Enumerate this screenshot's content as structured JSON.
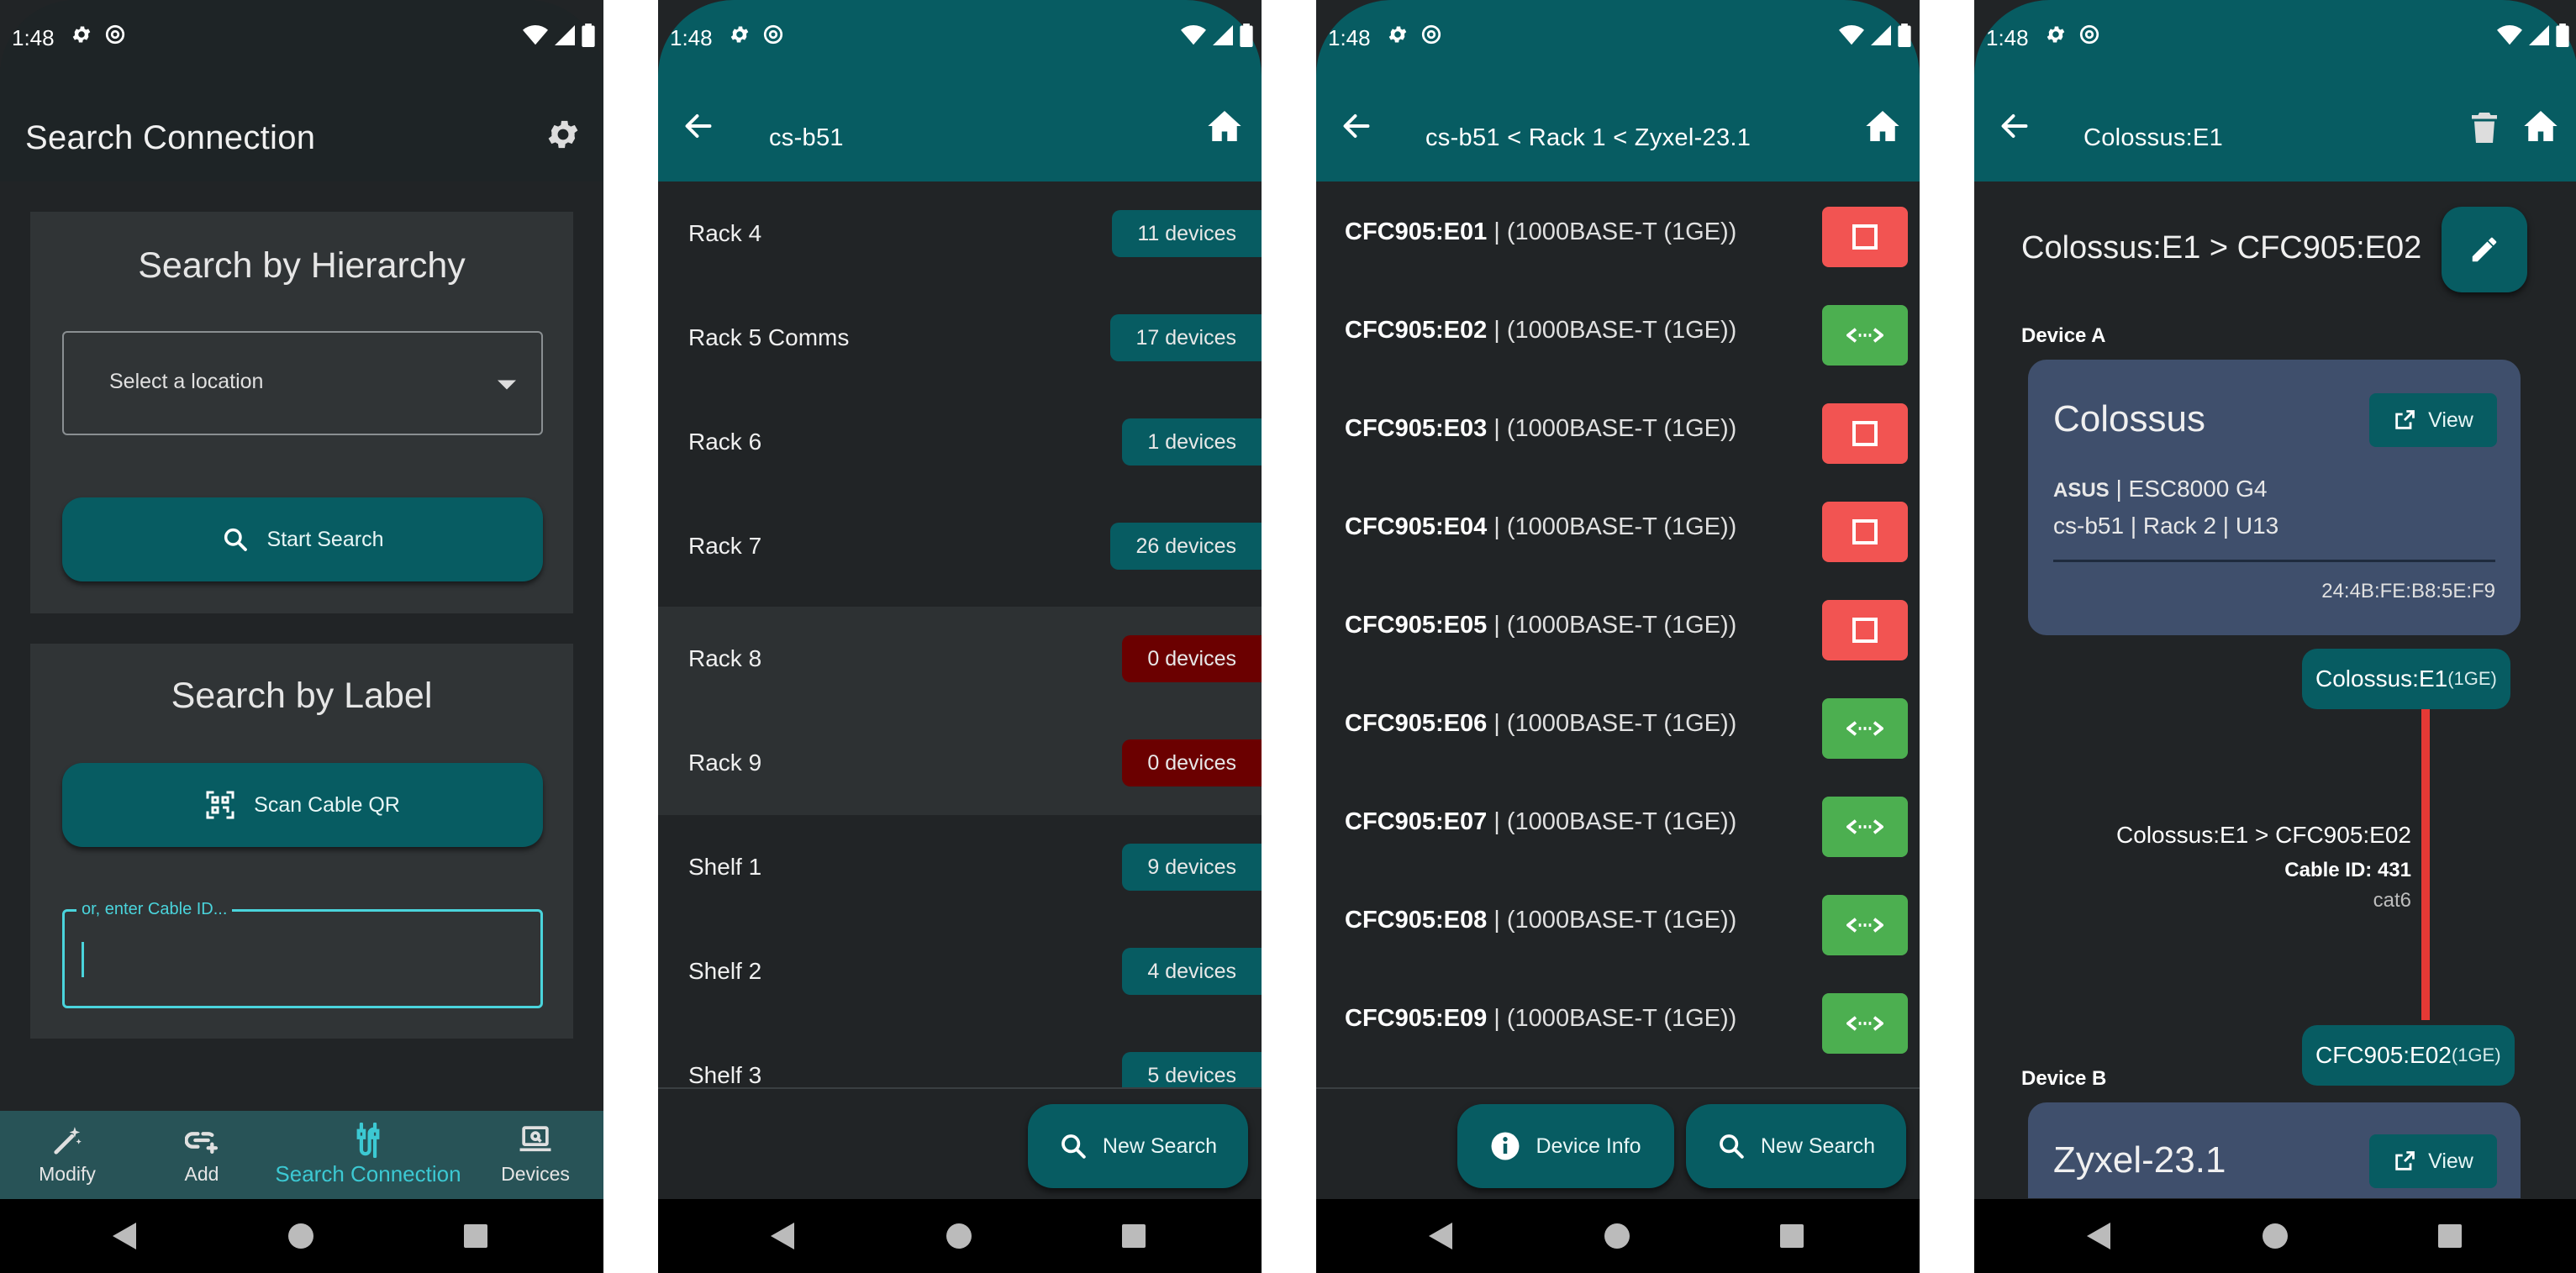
{
  "status": {
    "time": "1:48"
  },
  "colors": {
    "teal": "#075c62",
    "red_badge": "#6b0000",
    "port_red": "#f25452",
    "port_green": "#4caf50",
    "device_card": "#3f4f6c",
    "link_line": "#e53935"
  },
  "screen1": {
    "title": "Search Connection",
    "hierarchy": {
      "heading": "Search by Hierarchy",
      "select_placeholder": "Select a location",
      "start_button": "Start Search"
    },
    "label": {
      "heading": "Search by Label",
      "scan_button": "Scan Cable QR",
      "input_label": "or, enter Cable ID...",
      "input_value": ""
    },
    "bottom_nav": [
      {
        "label": "Modify",
        "icon": "wand-icon",
        "active": false
      },
      {
        "label": "Add",
        "icon": "link-add-icon",
        "active": false
      },
      {
        "label": "Search Connection",
        "icon": "cable-icon",
        "active": true
      },
      {
        "label": "Devices",
        "icon": "laptop-icon",
        "active": false
      }
    ]
  },
  "screen2": {
    "title": "cs-b51",
    "rows": [
      {
        "label": "Rack 4",
        "badge": "11 devices",
        "empty": false
      },
      {
        "label": "Rack 5 Comms",
        "badge": "17 devices",
        "empty": false
      },
      {
        "label": "Rack 6",
        "badge": "1 devices",
        "empty": false
      },
      {
        "label": "Rack 7",
        "badge": "26 devices",
        "empty": false
      },
      {
        "label": "Rack 8",
        "badge": "0 devices",
        "empty": true
      },
      {
        "label": "Rack 9",
        "badge": "0 devices",
        "empty": true
      },
      {
        "label": "Shelf 1",
        "badge": "9 devices",
        "empty": false
      },
      {
        "label": "Shelf 2",
        "badge": "4 devices",
        "empty": false
      },
      {
        "label": "Shelf 3",
        "badge": "5 devices",
        "empty": false
      }
    ],
    "new_search": "New Search"
  },
  "screen3": {
    "title": "cs-b51 < Rack 1 < Zyxel-23.1",
    "ports": [
      {
        "name": "CFC905:E01",
        "type": " | (1000BASE-T (1GE))",
        "connected": false
      },
      {
        "name": "CFC905:E02",
        "type": " | (1000BASE-T (1GE))",
        "connected": true
      },
      {
        "name": "CFC905:E03",
        "type": " | (1000BASE-T (1GE))",
        "connected": false
      },
      {
        "name": "CFC905:E04",
        "type": " | (1000BASE-T (1GE))",
        "connected": false
      },
      {
        "name": "CFC905:E05",
        "type": " | (1000BASE-T (1GE))",
        "connected": false
      },
      {
        "name": "CFC905:E06",
        "type": " | (1000BASE-T (1GE))",
        "connected": true
      },
      {
        "name": "CFC905:E07",
        "type": " | (1000BASE-T (1GE))",
        "connected": true
      },
      {
        "name": "CFC905:E08",
        "type": " | (1000BASE-T (1GE))",
        "connected": true
      },
      {
        "name": "CFC905:E09",
        "type": " | (1000BASE-T (1GE))",
        "connected": true
      }
    ],
    "device_info": "Device Info",
    "new_search": "New Search"
  },
  "screen4": {
    "title": "Colossus:E1",
    "heading": "Colossus:E1 > CFC905:E02",
    "device_a": {
      "section_label": "Device A",
      "name": "Colossus",
      "view": "View",
      "brand": "ASUS",
      "model": " | ESC8000 G4",
      "location": "cs-b51 | Rack 2 | U13",
      "mac": "24:4B:FE:B8:5E:F9",
      "port": "Colossus:E1",
      "port_speed": "(1GE)"
    },
    "cable": {
      "name": "Colossus:E1 > CFC905:E02",
      "cable_id": "Cable ID: 431",
      "type": "cat6"
    },
    "device_b": {
      "section_label": "Device B",
      "name": "Zyxel-23.1",
      "view": "View",
      "port": "CFC905:E02",
      "port_speed": "(1GE)"
    }
  }
}
